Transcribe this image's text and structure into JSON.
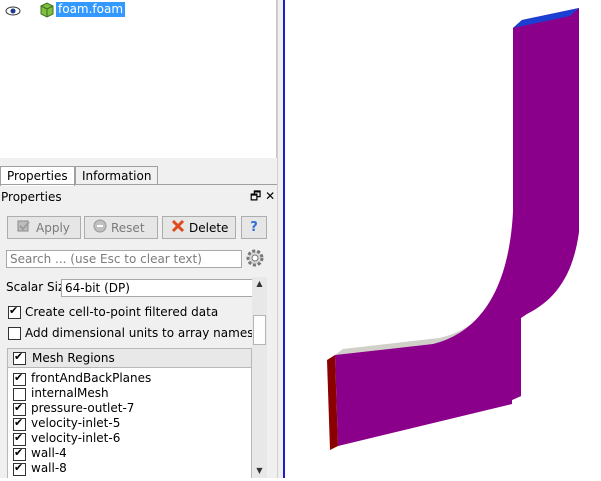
{
  "pipeline": {
    "item_label": "foam.foam"
  },
  "tabs": [
    {
      "label": "Properties"
    },
    {
      "label": "Information"
    }
  ],
  "properties_panel": {
    "title": "Properties",
    "dock_float": "🗗",
    "dock_close": "✕",
    "buttons": {
      "apply": "Apply",
      "reset": "Reset",
      "delete": "Delete",
      "help": "?"
    },
    "search_placeholder": "Search ... (use Esc to clear text)",
    "scalar_size_label": "Scalar Size",
    "scalar_size_value": "64-bit (DP)",
    "create_cell_to_point": {
      "label": "Create cell-to-point filtered data",
      "checked": true
    },
    "add_dimensional_units": {
      "label": "Add dimensional units to array names",
      "checked": false
    },
    "mesh_regions": {
      "header": "Mesh Regions",
      "header_checked": true,
      "items": [
        {
          "label": "frontAndBackPlanes",
          "checked": true
        },
        {
          "label": "internalMesh",
          "checked": false
        },
        {
          "label": "pressure-outlet-7",
          "checked": true
        },
        {
          "label": "velocity-inlet-5",
          "checked": true
        },
        {
          "label": "velocity-inlet-6",
          "checked": true
        },
        {
          "label": "wall-4",
          "checked": true
        },
        {
          "label": "wall-8",
          "checked": true
        }
      ]
    }
  },
  "colors": {
    "selection": "#3399ff",
    "viewport_border": "#1c1cce",
    "mesh_face": "#8b008b",
    "mesh_side": "#c0c0c0",
    "inlet_patch": "#8b0000",
    "outlet_patch": "#1a3fd1"
  },
  "icons": [
    "eye-icon",
    "cube-icon",
    "apply-icon",
    "reset-icon",
    "delete-icon",
    "help-icon",
    "gear-icon"
  ]
}
